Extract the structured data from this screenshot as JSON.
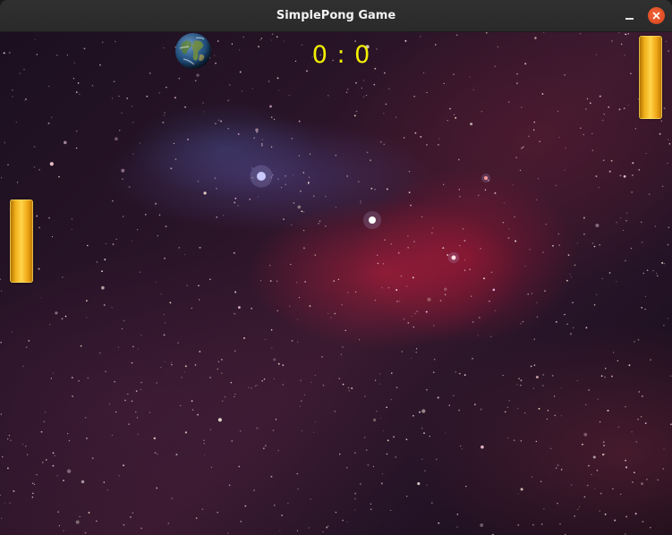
{
  "window": {
    "title": "SimplePong Game",
    "controls": {
      "minimize_icon": "minimize-icon",
      "close_icon": "close-icon"
    }
  },
  "game": {
    "score": {
      "left": 0,
      "right": 0,
      "separator": ":",
      "display": "0 : 0"
    },
    "ball_icon": "earth-globe-icon",
    "background": "space-nebula-starfield",
    "paddle_color": "#f5b81c",
    "score_color": "#f4f000"
  }
}
